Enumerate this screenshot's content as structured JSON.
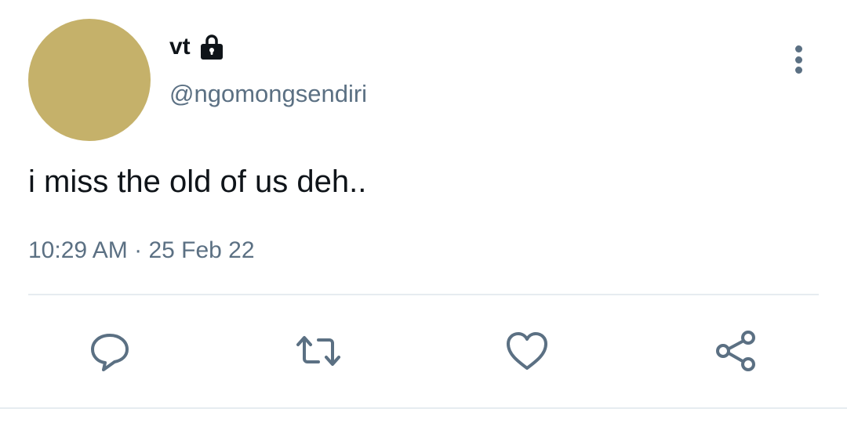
{
  "tweet": {
    "author": {
      "display_name": "vt",
      "handle": "@ngomongsendiri",
      "protected_icon": "lock-icon",
      "avatar_color": "#c5b16a"
    },
    "text": "i miss the old of us deh..",
    "time": "10:29 AM",
    "separator": "·",
    "date": "25 Feb 22"
  },
  "actions": {
    "reply_icon": "speech-bubble-icon",
    "retweet_icon": "retweet-arrows-icon",
    "like_icon": "heart-icon",
    "share_icon": "share-nodes-icon",
    "more_icon": "vertical-ellipsis-icon"
  },
  "colors": {
    "primary_text": "#0f1419",
    "secondary_text": "#5b7083",
    "divider": "#e6ecf0"
  }
}
